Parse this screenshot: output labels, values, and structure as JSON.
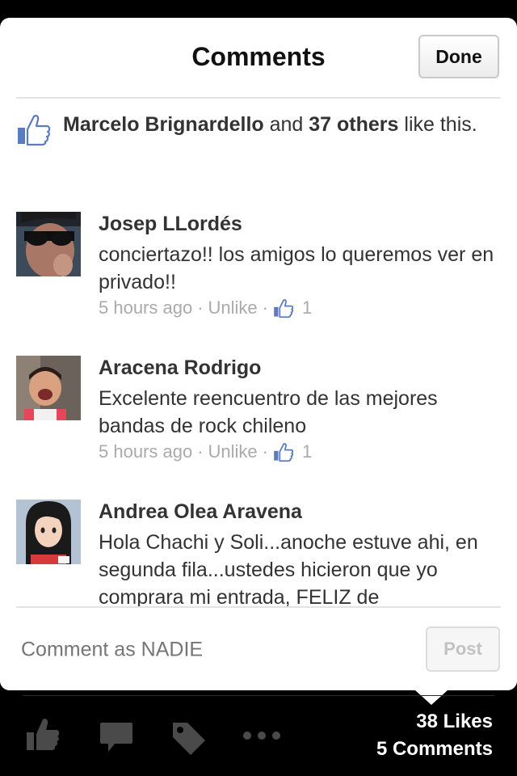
{
  "header": {
    "title": "Comments",
    "done_label": "Done"
  },
  "likes_summary": {
    "liker_name": "Marcelo Brignardello",
    "connector": " and ",
    "others": "37 others",
    "suffix": " like this."
  },
  "comments": [
    {
      "name": "Josep LLordés",
      "text": "conciertazo!!  los amigos lo queremos ver en privado!!",
      "time": "5 hours ago",
      "action": "Unlike",
      "separator": "·",
      "likes": "1"
    },
    {
      "name": "Aracena Rodrigo",
      "text": "Excelente reencuentro de las mejores bandas de rock chileno",
      "time": "5 hours ago",
      "action": "Unlike",
      "separator": "·",
      "likes": "1"
    },
    {
      "name": "Andrea Olea Aravena",
      "text": "Hola Chachi y Soli...anoche estuve ahi, en segunda fila...ustedes hicieron que yo comprara mi entrada, FELIZ de"
    }
  ],
  "composer": {
    "placeholder": "Comment as NADIE",
    "post_label": "Post"
  },
  "toolbar": {
    "likes_count": "38 Likes",
    "comments_count": "5 Comments",
    "icons": [
      "like-icon",
      "comment-icon",
      "tag-icon",
      "more-icon"
    ]
  },
  "colors": {
    "thumb_blue": "#5b7bc0",
    "meta_gray": "#aaaaaa",
    "background": "#000000"
  }
}
